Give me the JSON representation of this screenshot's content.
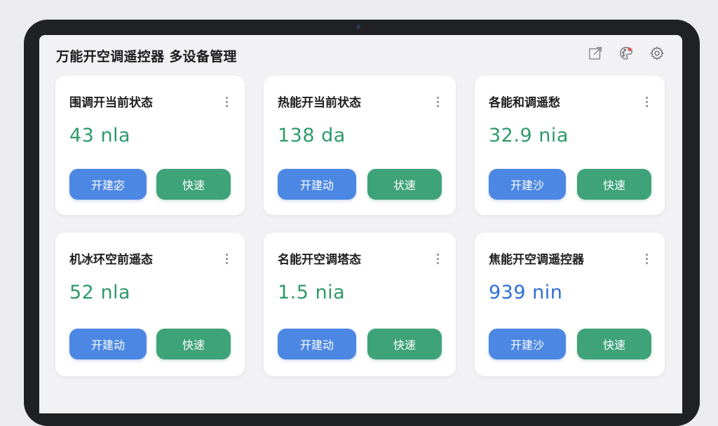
{
  "app": {
    "title": "万能开空调遥控器 多设备管理"
  },
  "toolbar": {
    "icons": [
      "share-icon",
      "palette-icon",
      "gear-icon"
    ]
  },
  "cards": [
    {
      "title": "围调开当前状态",
      "value": "43 nla",
      "value_color": "#2f9a6c",
      "primary_label": "开建宓",
      "secondary_label": "快速"
    },
    {
      "title": "热能开当前状态",
      "value": "138 da",
      "value_color": "#2f9a6c",
      "primary_label": "开建动",
      "secondary_label": "状速"
    },
    {
      "title": "各能和调遥愁",
      "value": "32.9 nia",
      "value_color": "#2f9a6c",
      "primary_label": "开建沙",
      "secondary_label": "快速"
    },
    {
      "title": "机冰环空前遥态",
      "value": "52 nla",
      "value_color": "#2f9a6c",
      "primary_label": "开建动",
      "secondary_label": "快速"
    },
    {
      "title": "名能开空调塔态",
      "value": "1.5 nia",
      "value_color": "#2f9a6c",
      "primary_label": "开建动",
      "secondary_label": "快速"
    },
    {
      "title": "焦能开空调遥控器",
      "value": "939 nin",
      "value_color": "#2d6fd6",
      "primary_label": "开建沙",
      "secondary_label": "快速"
    }
  ],
  "colors": {
    "primary_button": "#4c87e3",
    "secondary_button": "#3fa37a",
    "value_green": "#2f9a6c",
    "value_blue": "#2d6fd6"
  }
}
